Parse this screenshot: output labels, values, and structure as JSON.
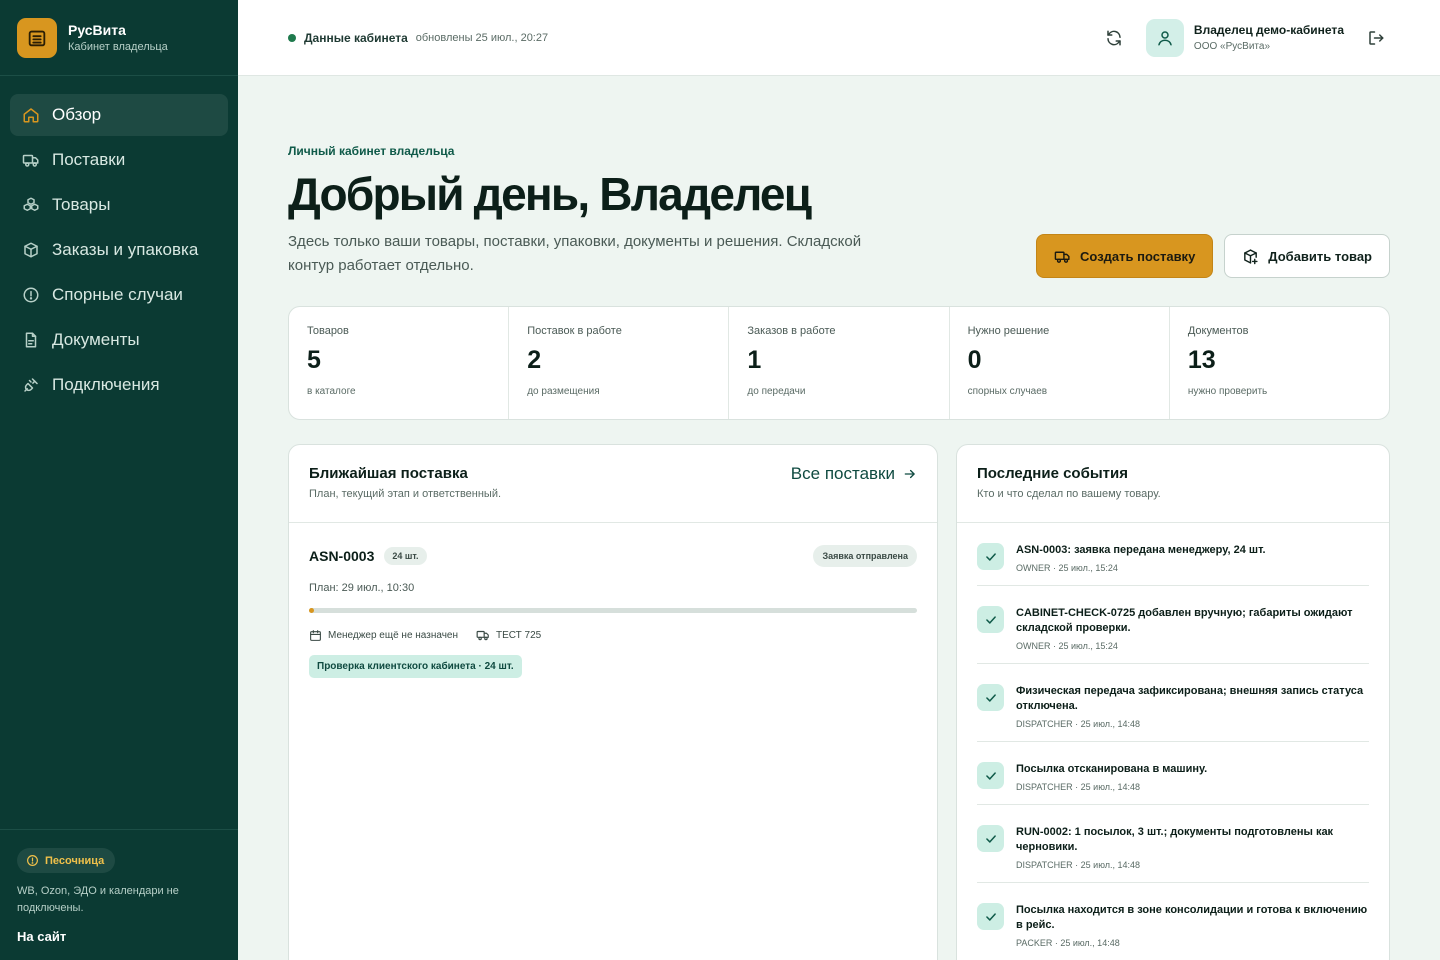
{
  "brand": {
    "name": "РусВита",
    "subtitle": "Кабинет владельца"
  },
  "nav": [
    {
      "label": "Обзор",
      "icon": "home-icon",
      "active": true
    },
    {
      "label": "Поставки",
      "icon": "truck-icon"
    },
    {
      "label": "Товары",
      "icon": "boxes-icon"
    },
    {
      "label": "Заказы и упаковка",
      "icon": "package-icon"
    },
    {
      "label": "Спорные случаи",
      "icon": "alert-circle-icon"
    },
    {
      "label": "Документы",
      "icon": "document-icon"
    },
    {
      "label": "Подключения",
      "icon": "plug-icon"
    }
  ],
  "sidebar_footer": {
    "badge": "Песочница",
    "note": "WB, Ozon, ЭДО и календари не подключены.",
    "site_link": "На сайт"
  },
  "topbar": {
    "status_title": "Данные кабинета",
    "status_time": "обновлены 25 июл., 20:27",
    "user_name": "Владелец демо-кабинета",
    "user_org": "ООО «РусВита»"
  },
  "hero": {
    "eyebrow": "Личный кабинет владельца",
    "greeting": "Добрый день, Владелец",
    "description": "Здесь только ваши товары, поставки, упаковки, документы и решения. Складской контур работает отдельно.",
    "primary_button": "Создать поставку",
    "secondary_button": "Добавить товар"
  },
  "stats": [
    {
      "label": "Товаров",
      "value": "5",
      "sub": "в каталоге"
    },
    {
      "label": "Поставок в работе",
      "value": "2",
      "sub": "до размещения"
    },
    {
      "label": "Заказов в работе",
      "value": "1",
      "sub": "до передачи"
    },
    {
      "label": "Нужно решение",
      "value": "0",
      "sub": "спорных случаев"
    },
    {
      "label": "Документов",
      "value": "13",
      "sub": "нужно проверить"
    }
  ],
  "shipment_panel": {
    "title": "Ближайшая поставка",
    "subtitle": "План, текущий этап и ответственный.",
    "link": "Все поставки",
    "shipment": {
      "id": "ASN-0003",
      "qty": "24 шт.",
      "state": "Заявка отправлена",
      "plan": "План: 29 июл., 10:30",
      "progress": 0.008,
      "manager": "Менеджер ещё не назначен",
      "vehicle": "ТЕСТ 725",
      "check_badge": "Проверка клиентского кабинета · 24 шт."
    }
  },
  "events_panel": {
    "title": "Последние события",
    "subtitle": "Кто и что сделал по вашему товару.",
    "events": [
      {
        "text": "ASN-0003: заявка передана менеджеру, 24 шт.",
        "meta": "OWNER · 25 июл., 15:24"
      },
      {
        "text": "CABINET-CHECK-0725 добавлен вручную; габариты ожидают складской проверки.",
        "meta": "OWNER · 25 июл., 15:24"
      },
      {
        "text": "Физическая передача зафиксирована; внешняя запись статуса отключена.",
        "meta": "DISPATCHER · 25 июл., 14:48"
      },
      {
        "text": "Посылка отсканирована в машину.",
        "meta": "DISPATCHER · 25 июл., 14:48"
      },
      {
        "text": "RUN-0002: 1 посылок, 3 шт.; документы подготовлены как черновики.",
        "meta": "DISPATCHER · 25 июл., 14:48"
      },
      {
        "text": "Посылка находится в зоне консолидации и готова к включению в рейс.",
        "meta": "PACKER · 25 июл., 14:48"
      }
    ]
  }
}
